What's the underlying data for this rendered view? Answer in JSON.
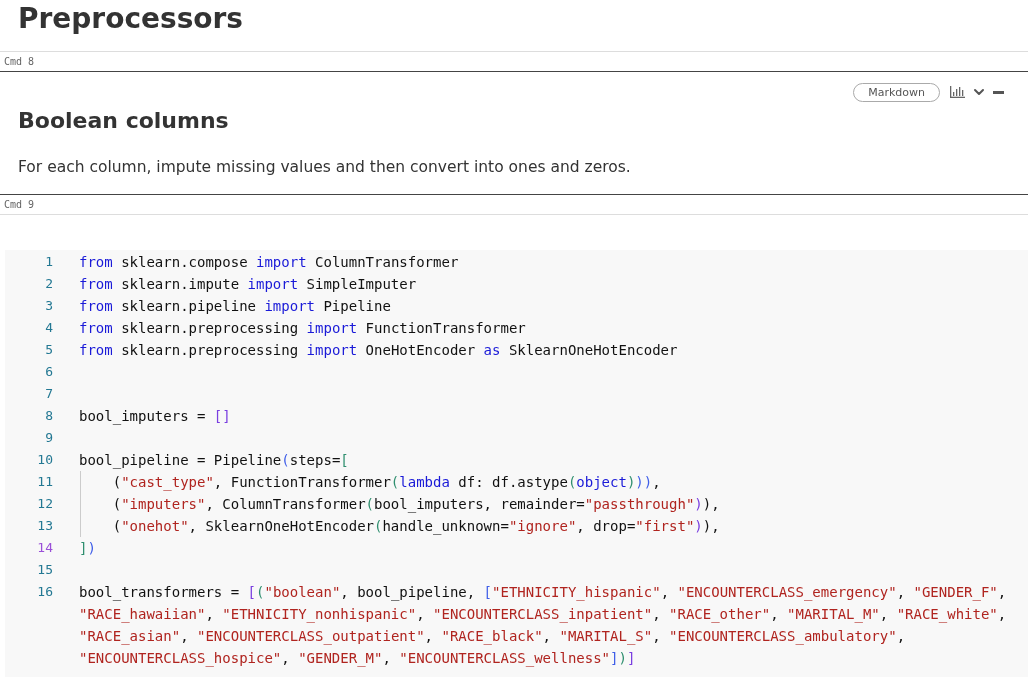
{
  "title": "Preprocessors",
  "cells": [
    {
      "kind": "markdown",
      "label": "Cmd 8",
      "toolbar": {
        "button": "Markdown"
      },
      "heading": "Boolean columns",
      "paragraph": "For each column, impute missing values and then convert into ones and zeros."
    },
    {
      "kind": "code",
      "label": "Cmd 9",
      "lines": [
        {
          "number": "1",
          "current": false,
          "guide": false,
          "rows": [
            {
              "tokens": [
                {
                  "kind": "keyword",
                  "text": "from"
                },
                {
                  "kind": "plain",
                  "text": " sklearn.compose "
                },
                {
                  "kind": "keyword",
                  "text": "import"
                },
                {
                  "kind": "plain",
                  "text": " ColumnTransformer"
                }
              ]
            }
          ]
        },
        {
          "number": "2",
          "current": false,
          "guide": false,
          "rows": [
            {
              "tokens": [
                {
                  "kind": "keyword",
                  "text": "from"
                },
                {
                  "kind": "plain",
                  "text": " sklearn.impute "
                },
                {
                  "kind": "keyword",
                  "text": "import"
                },
                {
                  "kind": "plain",
                  "text": " SimpleImputer"
                }
              ]
            }
          ]
        },
        {
          "number": "3",
          "current": false,
          "guide": false,
          "rows": [
            {
              "tokens": [
                {
                  "kind": "keyword",
                  "text": "from"
                },
                {
                  "kind": "plain",
                  "text": " sklearn.pipeline "
                },
                {
                  "kind": "keyword",
                  "text": "import"
                },
                {
                  "kind": "plain",
                  "text": " Pipeline"
                }
              ]
            }
          ]
        },
        {
          "number": "4",
          "current": false,
          "guide": false,
          "rows": [
            {
              "tokens": [
                {
                  "kind": "keyword",
                  "text": "from"
                },
                {
                  "kind": "plain",
                  "text": " sklearn.preprocessing "
                },
                {
                  "kind": "keyword",
                  "text": "import"
                },
                {
                  "kind": "plain",
                  "text": " FunctionTransformer"
                }
              ]
            }
          ]
        },
        {
          "number": "5",
          "current": false,
          "guide": false,
          "rows": [
            {
              "tokens": [
                {
                  "kind": "keyword",
                  "text": "from"
                },
                {
                  "kind": "plain",
                  "text": " sklearn.preprocessing "
                },
                {
                  "kind": "keyword",
                  "text": "import"
                },
                {
                  "kind": "plain",
                  "text": " OneHotEncoder "
                },
                {
                  "kind": "keyword",
                  "text": "as"
                },
                {
                  "kind": "plain",
                  "text": " SklearnOneHotEncoder"
                }
              ]
            }
          ]
        },
        {
          "number": "6",
          "current": false,
          "guide": false
        },
        {
          "number": "7",
          "current": false,
          "guide": false
        },
        {
          "number": "8",
          "current": false,
          "guide": false,
          "rows": [
            {
              "tokens": [
                {
                  "kind": "plain",
                  "text": "bool_imputers = "
                },
                {
                  "kind": "bracket3",
                  "text": "[]"
                }
              ]
            }
          ]
        },
        {
          "number": "9",
          "current": false,
          "guide": false
        },
        {
          "number": "10",
          "current": false,
          "guide": false,
          "rows": [
            {
              "tokens": [
                {
                  "kind": "plain",
                  "text": "bool_pipeline = Pipeline"
                },
                {
                  "kind": "bracket1",
                  "text": "("
                },
                {
                  "kind": "plain",
                  "text": "steps="
                },
                {
                  "kind": "bracket2",
                  "text": "["
                }
              ]
            }
          ]
        },
        {
          "number": "11",
          "current": false,
          "guide": true,
          "rows": [
            {
              "tokens": [
                {
                  "kind": "plain",
                  "text": "("
                },
                {
                  "kind": "string",
                  "text": "\"cast_type\""
                },
                {
                  "kind": "plain",
                  "text": ", FunctionTransformer"
                },
                {
                  "kind": "bracket2",
                  "text": "("
                },
                {
                  "kind": "keyword",
                  "text": "lambda"
                },
                {
                  "kind": "plain",
                  "text": " df: df.astype"
                },
                {
                  "kind": "bracket2",
                  "text": "("
                },
                {
                  "kind": "keyword",
                  "text": "object"
                },
                {
                  "kind": "bracket2",
                  "text": ")"
                },
                {
                  "kind": "bracket1",
                  "text": "))"
                },
                {
                  "kind": "plain",
                  "text": ","
                }
              ]
            }
          ]
        },
        {
          "number": "12",
          "current": false,
          "guide": true,
          "rows": [
            {
              "tokens": [
                {
                  "kind": "plain",
                  "text": "("
                },
                {
                  "kind": "string",
                  "text": "\"imputers\""
                },
                {
                  "kind": "plain",
                  "text": ", ColumnTransformer"
                },
                {
                  "kind": "bracket2",
                  "text": "("
                },
                {
                  "kind": "plain",
                  "text": "bool_imputers, remainder="
                },
                {
                  "kind": "string",
                  "text": "\"passthrough\""
                },
                {
                  "kind": "bracket3",
                  "text": ")"
                },
                {
                  "kind": "plain",
                  "text": "),"
                }
              ]
            }
          ]
        },
        {
          "number": "13",
          "current": false,
          "guide": true,
          "rows": [
            {
              "tokens": [
                {
                  "kind": "plain",
                  "text": "("
                },
                {
                  "kind": "string",
                  "text": "\"onehot\""
                },
                {
                  "kind": "plain",
                  "text": ", SklearnOneHotEncoder"
                },
                {
                  "kind": "bracket2",
                  "text": "("
                },
                {
                  "kind": "plain",
                  "text": "handle_unknown="
                },
                {
                  "kind": "string",
                  "text": "\"ignore\""
                },
                {
                  "kind": "plain",
                  "text": ", drop="
                },
                {
                  "kind": "string",
                  "text": "\"first\""
                },
                {
                  "kind": "bracket3",
                  "text": ")"
                },
                {
                  "kind": "plain",
                  "text": "),"
                }
              ]
            }
          ]
        },
        {
          "number": "14",
          "current": true,
          "guide": false,
          "rows": [
            {
              "tokens": [
                {
                  "kind": "bracket2",
                  "text": "]"
                },
                {
                  "kind": "bracket1",
                  "text": ")"
                }
              ]
            }
          ]
        },
        {
          "number": "15",
          "current": false,
          "guide": false
        },
        {
          "number": "16",
          "current": false,
          "guide": false,
          "rows": [
            {
              "tokens": [
                {
                  "kind": "plain",
                  "text": "bool_transformers = "
                },
                {
                  "kind": "bracket3",
                  "text": "["
                },
                {
                  "kind": "bracket2",
                  "text": "("
                },
                {
                  "kind": "string",
                  "text": "\"boolean\""
                },
                {
                  "kind": "plain",
                  "text": ", bool_pipeline, "
                },
                {
                  "kind": "bracket1",
                  "text": "["
                },
                {
                  "kind": "string",
                  "text": "\"ETHNICITY_hispanic\""
                },
                {
                  "kind": "plain",
                  "text": ", "
                },
                {
                  "kind": "string",
                  "text": "\"ENCOUNTERCLASS_emergency\""
                },
                {
                  "kind": "plain",
                  "text": ", "
                },
                {
                  "kind": "string",
                  "text": "\"GENDER_F\""
                },
                {
                  "kind": "plain",
                  "text": ","
                }
              ]
            },
            {
              "tokens": [
                {
                  "kind": "string",
                  "text": "\"RACE_hawaiian\""
                },
                {
                  "kind": "plain",
                  "text": ", "
                },
                {
                  "kind": "string",
                  "text": "\"ETHNICITY_nonhispanic\""
                },
                {
                  "kind": "plain",
                  "text": ", "
                },
                {
                  "kind": "string",
                  "text": "\"ENCOUNTERCLASS_inpatient\""
                },
                {
                  "kind": "plain",
                  "text": ", "
                },
                {
                  "kind": "string",
                  "text": "\"RACE_other\""
                },
                {
                  "kind": "plain",
                  "text": ", "
                },
                {
                  "kind": "string",
                  "text": "\"MARITAL_M\""
                },
                {
                  "kind": "plain",
                  "text": ", "
                },
                {
                  "kind": "string",
                  "text": "\"RACE_white\""
                },
                {
                  "kind": "plain",
                  "text": ","
                }
              ]
            },
            {
              "tokens": [
                {
                  "kind": "string",
                  "text": "\"RACE_asian\""
                },
                {
                  "kind": "plain",
                  "text": ", "
                },
                {
                  "kind": "string",
                  "text": "\"ENCOUNTERCLASS_outpatient\""
                },
                {
                  "kind": "plain",
                  "text": ", "
                },
                {
                  "kind": "string",
                  "text": "\"RACE_black\""
                },
                {
                  "kind": "plain",
                  "text": ", "
                },
                {
                  "kind": "string",
                  "text": "\"MARITAL_S\""
                },
                {
                  "kind": "plain",
                  "text": ", "
                },
                {
                  "kind": "string",
                  "text": "\"ENCOUNTERCLASS_ambulatory\""
                },
                {
                  "kind": "plain",
                  "text": ","
                }
              ]
            },
            {
              "tokens": [
                {
                  "kind": "string",
                  "text": "\"ENCOUNTERCLASS_hospice\""
                },
                {
                  "kind": "plain",
                  "text": ", "
                },
                {
                  "kind": "string",
                  "text": "\"GENDER_M\""
                },
                {
                  "kind": "plain",
                  "text": ", "
                },
                {
                  "kind": "string",
                  "text": "\"ENCOUNTERCLASS_wellness\""
                },
                {
                  "kind": "bracket1",
                  "text": "]"
                },
                {
                  "kind": "bracket2",
                  "text": ")"
                },
                {
                  "kind": "bracket3",
                  "text": "]"
                }
              ]
            }
          ]
        }
      ]
    }
  ]
}
